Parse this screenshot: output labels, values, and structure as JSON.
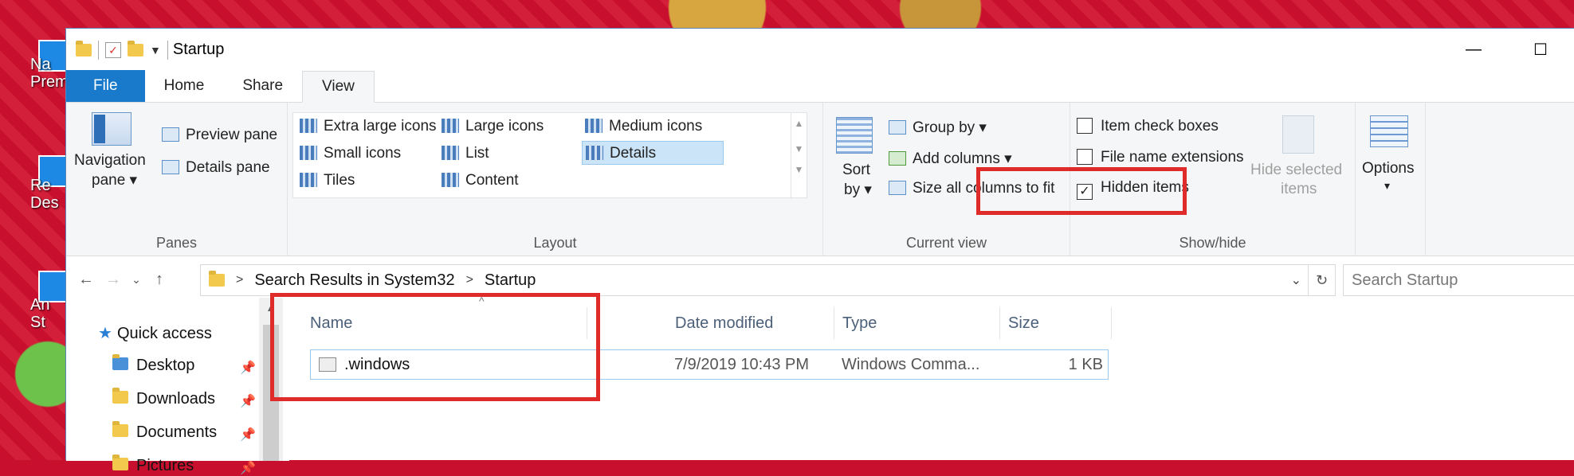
{
  "window": {
    "title": "Startup",
    "minimize_glyph": "—",
    "maximize_glyph": "☐"
  },
  "tabs": [
    {
      "label": "File"
    },
    {
      "label": "Home"
    },
    {
      "label": "Share"
    },
    {
      "label": "View"
    }
  ],
  "ribbon": {
    "panes": {
      "group_label": "Panes",
      "navigation_pane_line1": "Navigation",
      "navigation_pane_line2": "pane ▾",
      "preview_pane": "Preview pane",
      "details_pane": "Details pane"
    },
    "layout": {
      "group_label": "Layout",
      "items": {
        "extra_large_icons": "Extra large icons",
        "large_icons": "Large icons",
        "medium_icons": "Medium icons",
        "small_icons": "Small icons",
        "list": "List",
        "details": "Details",
        "tiles": "Tiles",
        "content": "Content"
      },
      "selected": "Details"
    },
    "current_view": {
      "group_label": "Current view",
      "sort_by_line1": "Sort",
      "sort_by_line2": "by ▾",
      "group_by": "Group by ▾",
      "add_columns": "Add columns ▾",
      "size_all_columns": "Size all columns to fit"
    },
    "show_hide": {
      "group_label": "Show/hide",
      "item_check_boxes": {
        "label": "Item check boxes",
        "checked": false
      },
      "file_name_extensions": {
        "label": "File name extensions",
        "checked": false
      },
      "hidden_items": {
        "label": "Hidden items",
        "checked": true
      },
      "hide_selected_line1": "Hide selected",
      "hide_selected_line2": "items"
    },
    "options": {
      "label": "Options",
      "arrow": "▾"
    }
  },
  "address_bar": {
    "crumbs": [
      "Search Results in System32",
      "Startup"
    ],
    "search_placeholder": "Search Startup"
  },
  "nav_pane": {
    "quick_access": "Quick access",
    "items": [
      {
        "label": "Desktop",
        "pinned": true
      },
      {
        "label": "Downloads",
        "pinned": true
      },
      {
        "label": "Documents",
        "pinned": true
      },
      {
        "label": "Pictures",
        "pinned": true
      }
    ]
  },
  "file_list": {
    "columns": [
      "Name",
      "Date modified",
      "Type",
      "Size"
    ],
    "rows": [
      {
        "name": ".windows",
        "date_modified": "7/9/2019 10:43 PM",
        "type": "Windows Comma...",
        "size": "1 KB"
      }
    ]
  },
  "desktop": {
    "labels": [
      "Na",
      "Prem",
      "Re",
      "Des",
      "An",
      "St"
    ]
  },
  "colors": {
    "accent": "#1979ca",
    "highlight_box": "#e02b2b",
    "selection": "#cce4f7"
  }
}
